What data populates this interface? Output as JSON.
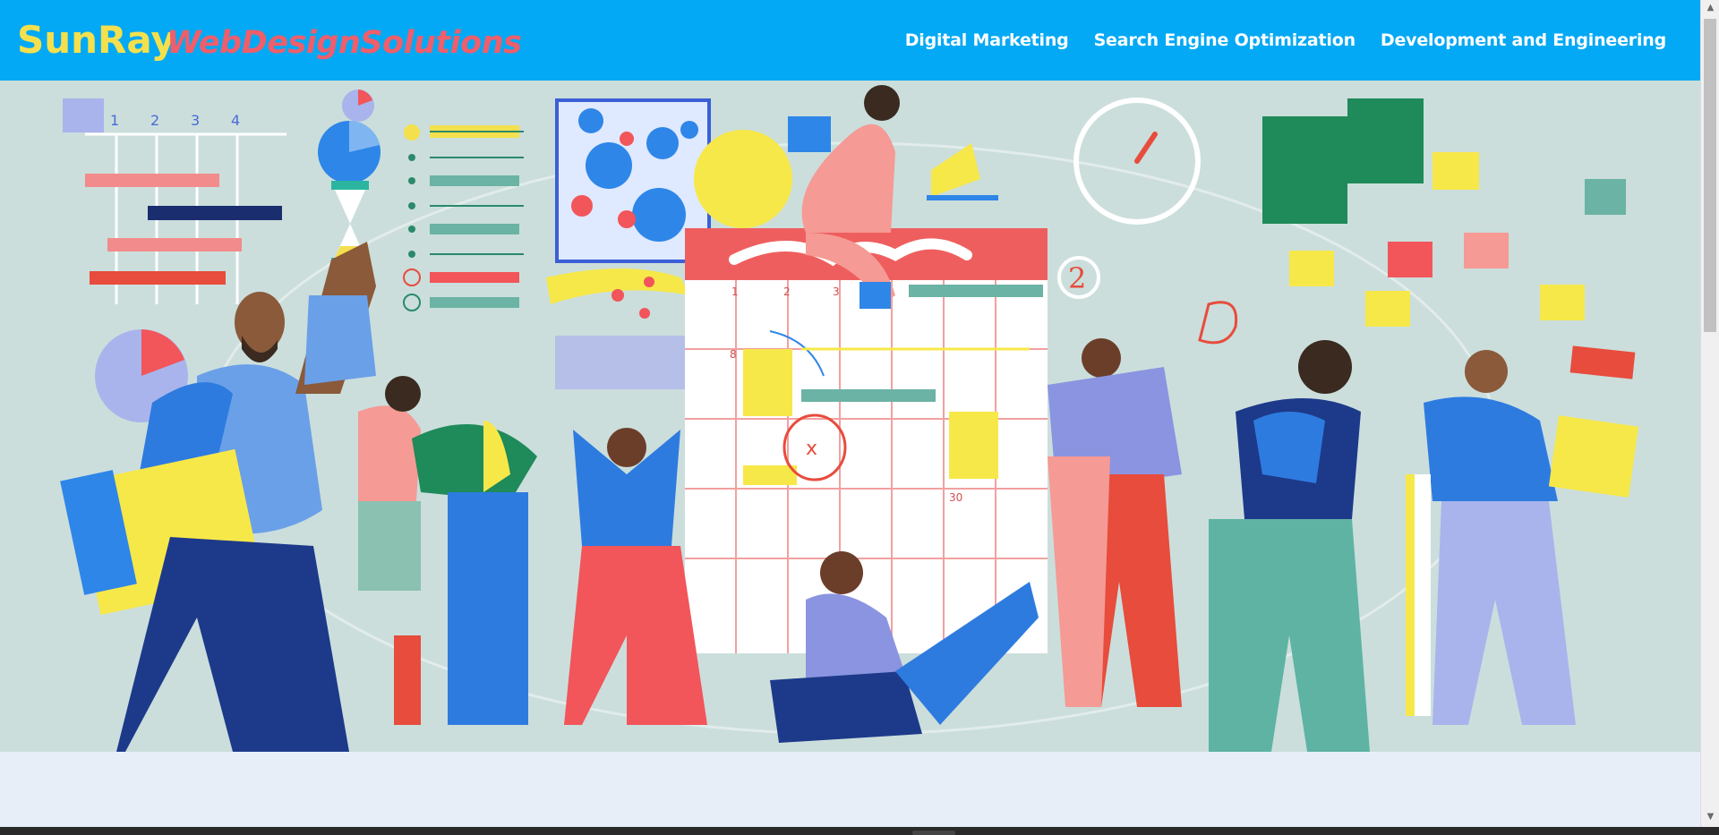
{
  "header": {
    "logo_main": "SunRay",
    "logo_sub": "WebDesignSolutions",
    "nav": [
      {
        "label": "Digital Marketing"
      },
      {
        "label": "Search Engine Optimization"
      },
      {
        "label": "Development and Engineering"
      }
    ]
  },
  "hero": {
    "calendar_numbers": [
      "1",
      "2",
      "3",
      "8",
      "30"
    ],
    "chart_numbers": [
      "1",
      "2",
      "3",
      "4"
    ],
    "clock_number": "2"
  },
  "colors": {
    "header_bg": "#03a9f4",
    "logo_main": "#f4e04d",
    "logo_sub": "#ef5e6b",
    "hero_bg": "#c9dcda"
  },
  "scrollbar": {
    "up_icon": "▲",
    "down_icon": "▼"
  }
}
